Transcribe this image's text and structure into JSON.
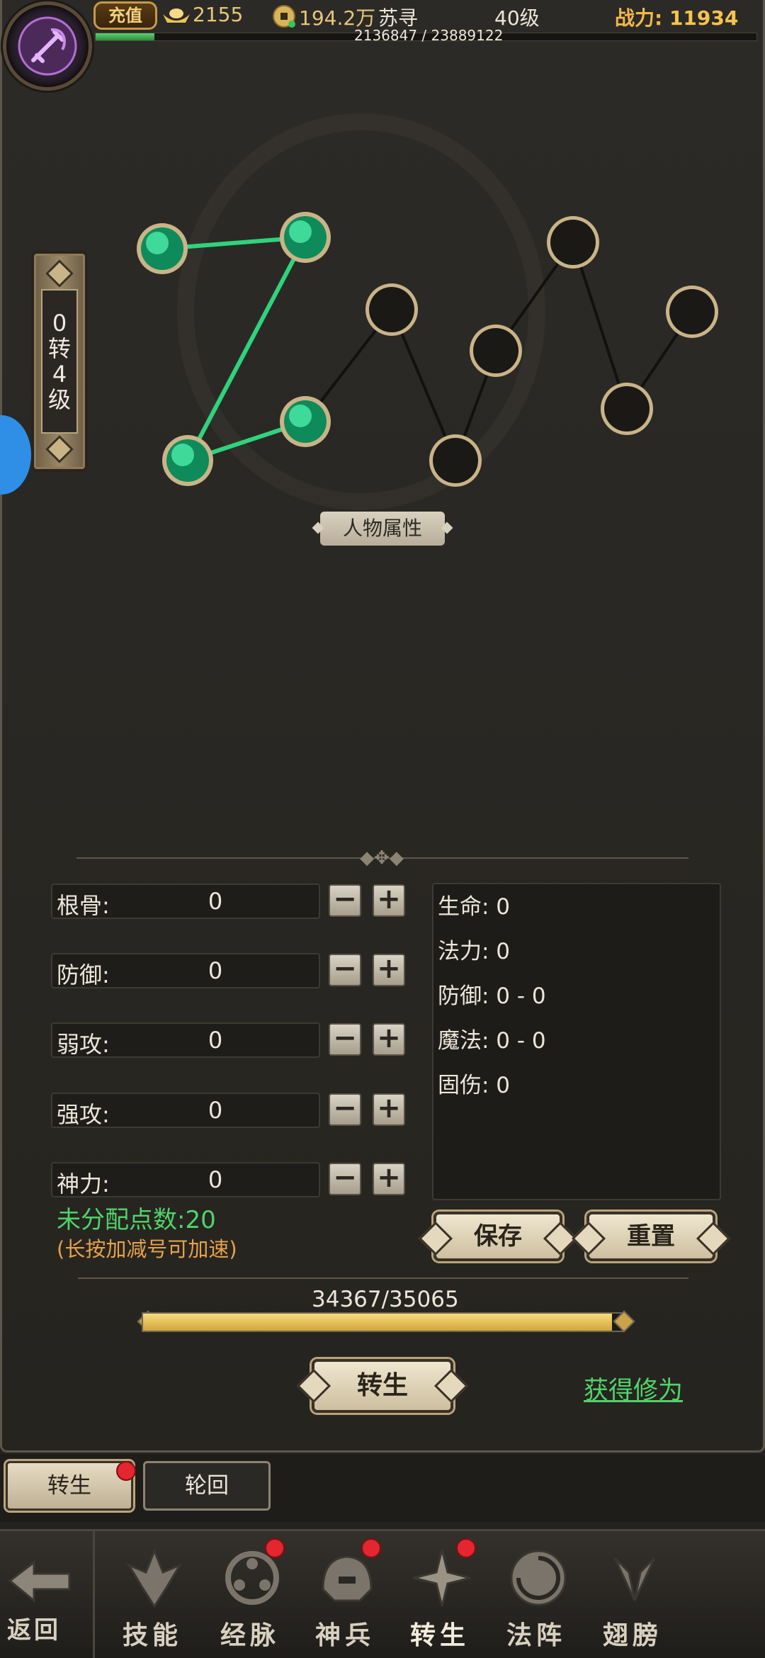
{
  "topbar": {
    "recharge_label": "充值",
    "gold": "2155",
    "money": "194.2万",
    "player_name": "苏寻",
    "player_level": "40级",
    "power_label": "战力:",
    "power_value": "11934",
    "exp_text": "2136847 / 23889122",
    "exp_fraction": 0.0894
  },
  "rebirth_tag": {
    "line1": "0",
    "line2": "转",
    "line3": "4",
    "line4": "级"
  },
  "graph": {
    "label": "人物属性",
    "lit_nodes": 4,
    "total_nodes": 11
  },
  "stats": [
    {
      "name": "根骨:",
      "value": "0"
    },
    {
      "name": "防御:",
      "value": "0"
    },
    {
      "name": "弱攻:",
      "value": "0"
    },
    {
      "name": "强攻:",
      "value": "0"
    },
    {
      "name": "神力:",
      "value": "0"
    }
  ],
  "minus_label": "−",
  "plus_label": "+",
  "unassigned_text": "未分配点数:20",
  "hint_text": "(长按加减号可加速)",
  "results": [
    "生命: 0",
    "法力: 0",
    "防御: 0 - 0",
    "魔法: 0 - 0",
    "固伤: 0"
  ],
  "buttons": {
    "save": "保存",
    "reset": "重置",
    "rebirth": "转生"
  },
  "progress": {
    "text": "34367/35065",
    "fraction": 0.98
  },
  "gain_link": "获得修为",
  "subtabs": {
    "active": "转生",
    "idle": "轮回"
  },
  "nav": {
    "back": "返回",
    "items": [
      "技能",
      "经脉",
      "神兵",
      "转生",
      "法阵",
      "翅膀"
    ]
  },
  "colors": {
    "accent_green": "#4fd46a",
    "gold": "#f6c34f",
    "badge_red": "#e3262f"
  }
}
